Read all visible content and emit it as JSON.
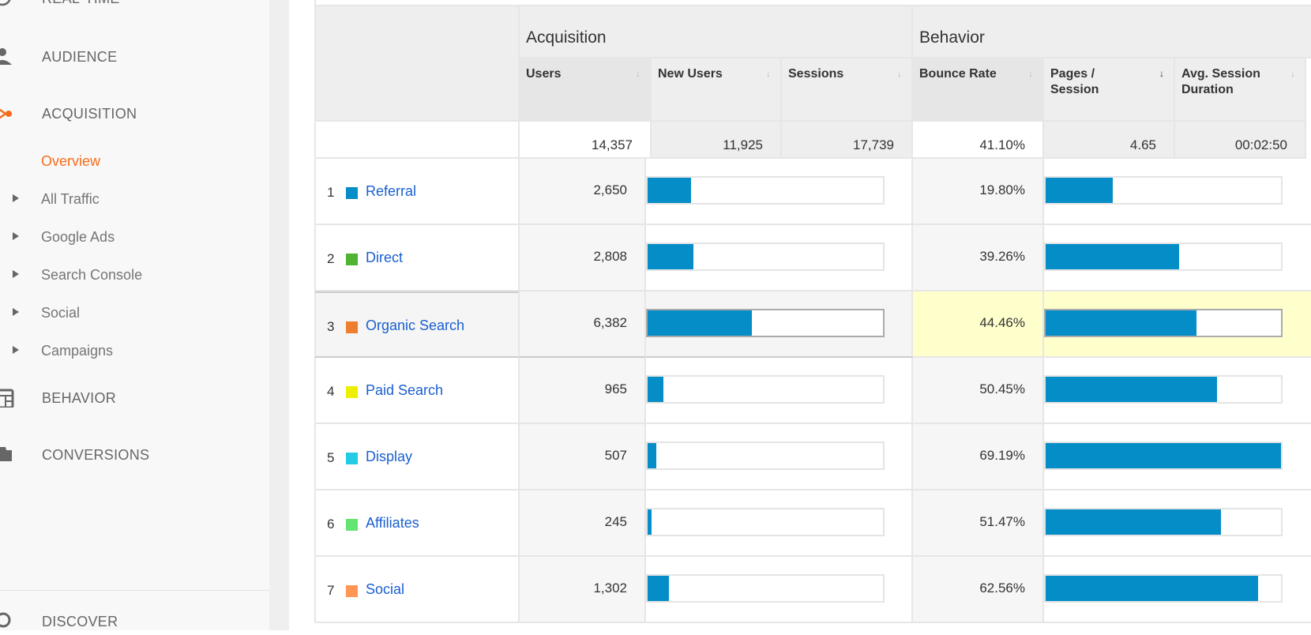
{
  "sidebar": {
    "items": [
      {
        "label": "REAL-TIME",
        "icon": "clock-icon"
      },
      {
        "label": "AUDIENCE",
        "icon": "person-icon"
      },
      {
        "label": "ACQUISITION",
        "icon": "acquisition-icon"
      },
      {
        "label": "BEHAVIOR",
        "icon": "behavior-icon"
      },
      {
        "label": "CONVERSIONS",
        "icon": "flag-icon"
      },
      {
        "label": "DISCOVER",
        "icon": "lightbulb-icon"
      }
    ],
    "sub": [
      "Overview",
      "All Traffic",
      "Google Ads",
      "Search Console",
      "Social",
      "Campaigns"
    ]
  },
  "table": {
    "groups": [
      "Acquisition",
      "Behavior"
    ],
    "columns": [
      "Users",
      "New Users",
      "Sessions",
      "Bounce Rate",
      "Pages / Session",
      "Avg. Session Duration"
    ],
    "sorted_column": "Pages / Session",
    "totals": [
      "14,357",
      "11,925",
      "17,739",
      "41.10%",
      "4.65",
      "00:02:50"
    ],
    "bar_color": "#058dc7",
    "rows": [
      {
        "rank": "1",
        "name": "Referral",
        "color": "#058dc7",
        "users": "2,650",
        "bounce": "19.80%",
        "users_n": 2650,
        "bounce_n": 19.8
      },
      {
        "rank": "2",
        "name": "Direct",
        "color": "#50b432",
        "users": "2,808",
        "bounce": "39.26%",
        "users_n": 2808,
        "bounce_n": 39.26
      },
      {
        "rank": "3",
        "name": "Organic Search",
        "color": "#ed7e2f",
        "users": "6,382",
        "bounce": "44.46%",
        "users_n": 6382,
        "bounce_n": 44.46,
        "highlighted": true
      },
      {
        "rank": "4",
        "name": "Paid Search",
        "color": "#edef00",
        "users": "965",
        "bounce": "50.45%",
        "users_n": 965,
        "bounce_n": 50.45
      },
      {
        "rank": "5",
        "name": "Display",
        "color": "#24cbe5",
        "users": "507",
        "bounce": "69.19%",
        "users_n": 507,
        "bounce_n": 69.19
      },
      {
        "rank": "6",
        "name": "Affiliates",
        "color": "#64e572",
        "users": "245",
        "bounce": "51.47%",
        "users_n": 245,
        "bounce_n": 51.47
      },
      {
        "rank": "7",
        "name": "Social",
        "color": "#ff9655",
        "users": "1,302",
        "bounce": "62.56%",
        "users_n": 1302,
        "bounce_n": 62.56
      }
    ]
  }
}
